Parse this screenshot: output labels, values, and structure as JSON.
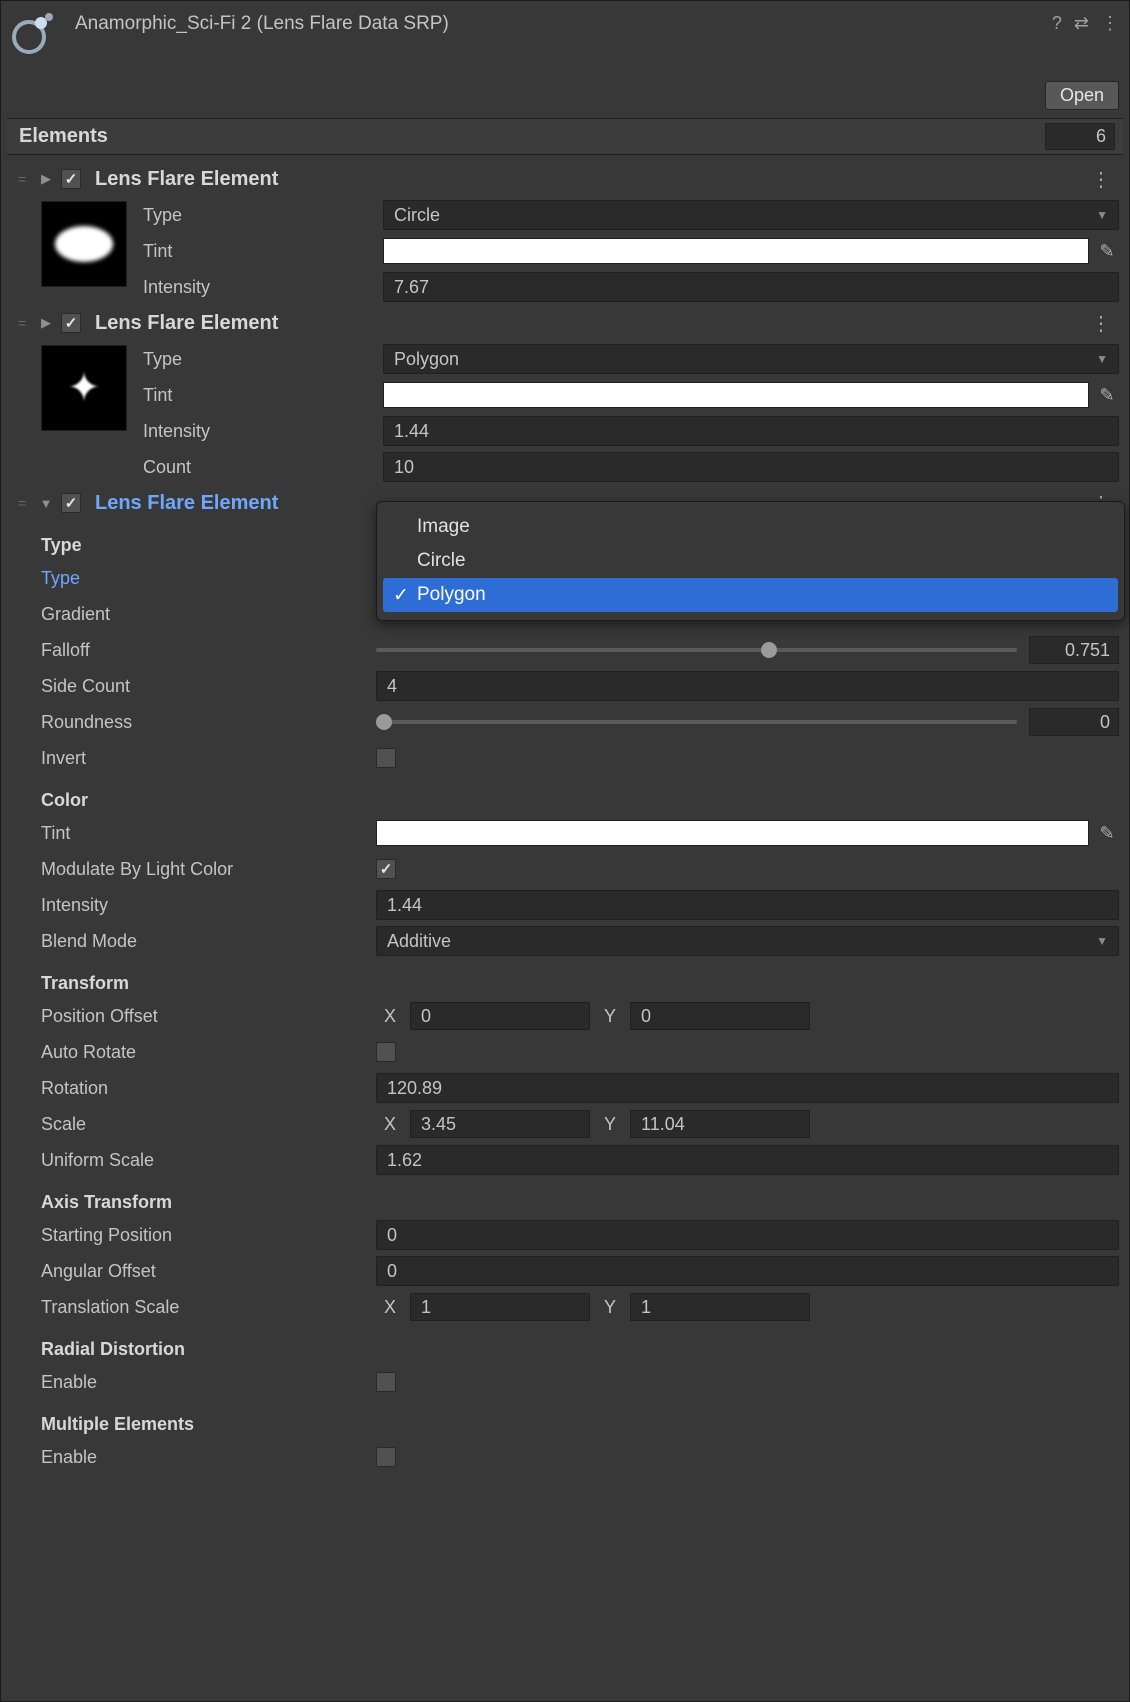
{
  "header": {
    "title": "Anamorphic_Sci-Fi 2 (Lens Flare Data SRP)",
    "open_label": "Open"
  },
  "elements_header": {
    "title": "Elements",
    "count": "6"
  },
  "labels": {
    "type": "Type",
    "tint": "Tint",
    "intensity": "Intensity",
    "count": "Count",
    "gradient": "Gradient",
    "falloff": "Falloff",
    "side_count": "Side Count",
    "roundness": "Roundness",
    "invert": "Invert",
    "modulate": "Modulate By Light Color",
    "blend_mode": "Blend Mode",
    "position_offset": "Position Offset",
    "auto_rotate": "Auto Rotate",
    "rotation": "Rotation",
    "scale": "Scale",
    "uniform_scale": "Uniform Scale",
    "starting_position": "Starting Position",
    "angular_offset": "Angular Offset",
    "translation_scale": "Translation Scale",
    "enable": "Enable",
    "x": "X",
    "y": "Y"
  },
  "sections": {
    "type": "Type",
    "color": "Color",
    "transform": "Transform",
    "axis_transform": "Axis Transform",
    "radial_distortion": "Radial Distortion",
    "multiple_elements": "Multiple Elements"
  },
  "foldout_title": "Lens Flare Element",
  "element1": {
    "type": "Circle",
    "intensity": "7.67"
  },
  "element2": {
    "type": "Polygon",
    "intensity": "1.44",
    "count": "10"
  },
  "element3": {
    "falloff": "0.751",
    "falloff_pct": 60,
    "side_count": "4",
    "roundness": "0",
    "roundness_pct": 0,
    "intensity": "1.44",
    "blend_mode": "Additive",
    "pos_x": "0",
    "pos_y": "0",
    "rotation": "120.89",
    "scale_x": "3.45",
    "scale_y": "11.04",
    "uniform_scale": "1.62",
    "starting_position": "0",
    "angular_offset": "0",
    "trans_x": "1",
    "trans_y": "1"
  },
  "popup": {
    "options": {
      "image": "Image",
      "circle": "Circle",
      "polygon": "Polygon"
    }
  }
}
